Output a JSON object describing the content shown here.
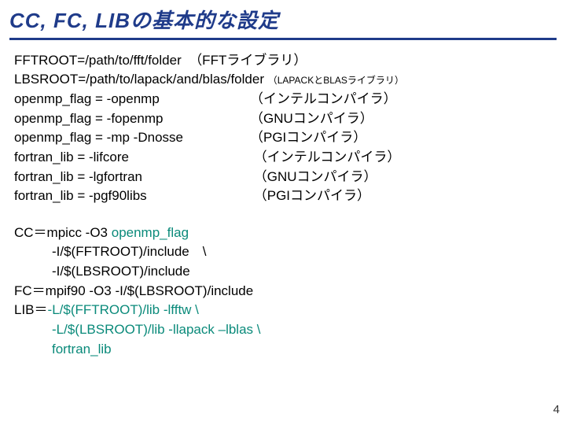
{
  "title": "CC, FC, LIBの基本的な設定",
  "defs": {
    "l1a": "FFTROOT=/path/to/fft/folder",
    "l1b": "（FFTライブラリ）",
    "l2a": "LBSROOT=/path/to/lapack/and/blas/folder",
    "l2b": "（LAPACKとBLASライブラリ）",
    "l3a": "openmp_flag = -openmp",
    "l3b": "（インテルコンパイラ）",
    "l4a": "openmp_flag = -fopenmp",
    "l4b": "（GNUコンパイラ）",
    "l5a": "openmp_flag = -mp -Dnosse",
    "l5b": "（PGIコンパイラ）",
    "l6a": "fortran_lib = -lifcore",
    "l6b": "（インテルコンパイラ）",
    "l7a": "fortran_lib = -lgfortran",
    "l7b": "（GNUコンパイラ）",
    "l8a": "fortran_lib = -pgf90libs",
    "l8b": "（PGIコンパイラ）"
  },
  "set": {
    "cc1": "CC＝mpicc -O3 ",
    "cc1g": "openmp_flag",
    "cc2": "-I/$(FFTROOT)/include　\\",
    "cc3": "-I/$(LBSROOT)/include",
    "fc": "FC＝mpif90 -O3 -I/$(LBSROOT)/include",
    "lib1a": "LIB＝",
    "lib1b": "-L/$(FFTROOT)/lib -lfftw \\",
    "lib2": "-L/$(LBSROOT)/lib -llapack –lblas \\",
    "lib3": "fortran_lib"
  },
  "page": "4"
}
